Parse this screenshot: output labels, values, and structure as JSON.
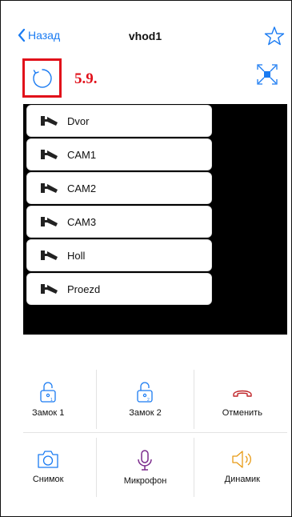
{
  "nav": {
    "back_label": "Назад",
    "title": "vhod1"
  },
  "annotation": "5.9.",
  "cameras": [
    {
      "label": "Dvor"
    },
    {
      "label": "CAM1"
    },
    {
      "label": "CAM2"
    },
    {
      "label": "CAM3"
    },
    {
      "label": "Holl"
    },
    {
      "label": "Proezd"
    }
  ],
  "controls": {
    "lock1": "Замок 1",
    "lock2": "Замок 2",
    "cancel": "Отменить",
    "snapshot": "Снимок",
    "microphone": "Микрофон",
    "speaker": "Динамик"
  },
  "colors": {
    "accent": "#1a7bf2",
    "annotation": "#e1101a",
    "cancel": "#c0262a",
    "microphone": "#7b2a8c",
    "speaker": "#e89a14"
  }
}
